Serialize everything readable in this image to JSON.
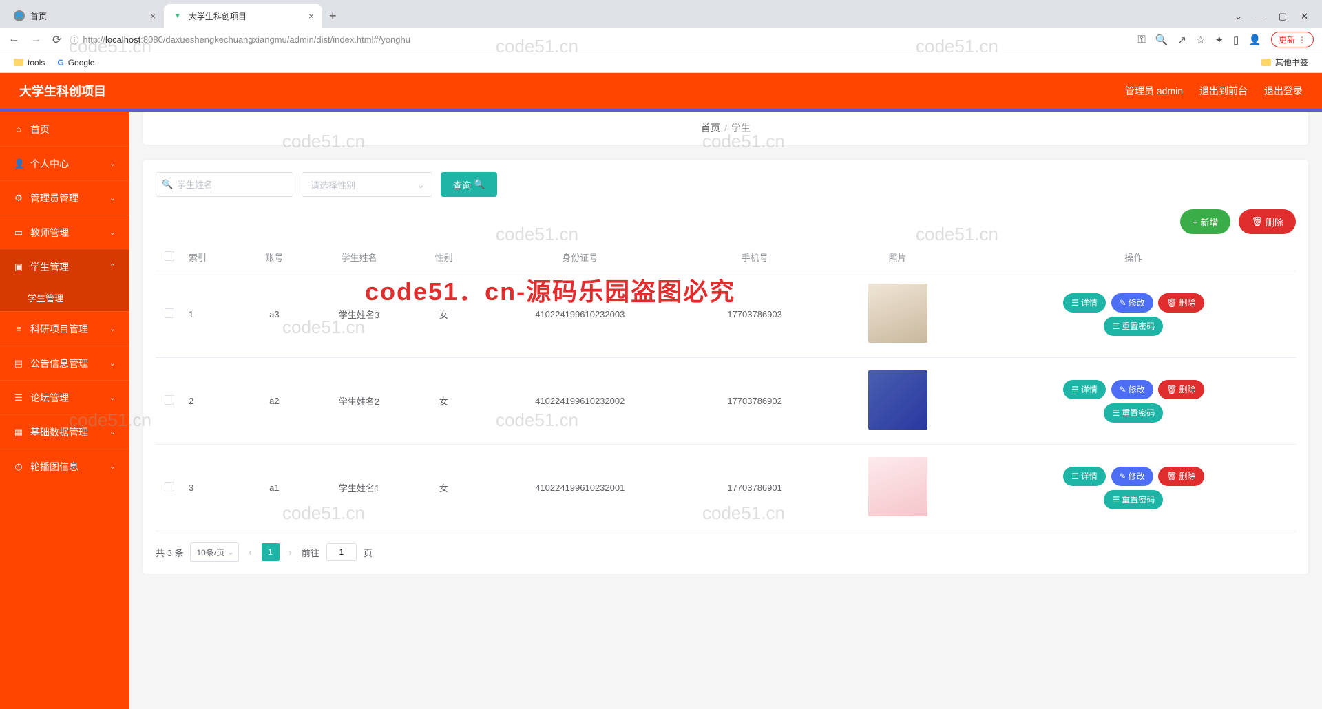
{
  "browser": {
    "tabs": [
      {
        "label": "首页",
        "active": false
      },
      {
        "label": "大学生科创项目",
        "active": true
      }
    ],
    "url_prefix": "http://",
    "url_host": "localhost",
    "url_rest": ":8080/daxueshengkechuangxiangmu/admin/dist/index.html#/yonghu",
    "update": "更新",
    "bookmarks": {
      "tools": "tools",
      "google": "Google",
      "other": "其他书签"
    }
  },
  "header": {
    "title": "大学生科创项目",
    "user": "管理员 admin",
    "front": "退出到前台",
    "logout": "退出登录"
  },
  "sidebar": [
    {
      "icon": "⌂",
      "label": "首页",
      "exp": ""
    },
    {
      "icon": "👤",
      "label": "个人中心",
      "exp": "⌄"
    },
    {
      "icon": "⚙",
      "label": "管理员管理",
      "exp": "⌄"
    },
    {
      "icon": "▭",
      "label": "教师管理",
      "exp": "⌄"
    },
    {
      "icon": "▣",
      "label": "学生管理",
      "exp": "⌃",
      "active": true,
      "sublabel": "学生管理"
    },
    {
      "icon": "≡",
      "label": "科研项目管理",
      "exp": "⌄"
    },
    {
      "icon": "▤",
      "label": "公告信息管理",
      "exp": "⌄"
    },
    {
      "icon": "☰",
      "label": "论坛管理",
      "exp": "⌄"
    },
    {
      "icon": "▦",
      "label": "基础数据管理",
      "exp": "⌄"
    },
    {
      "icon": "◷",
      "label": "轮播图信息",
      "exp": "⌄"
    }
  ],
  "breadcrumb": {
    "home": "首页",
    "current": "学生"
  },
  "filters": {
    "name_placeholder": "学生姓名",
    "gender_placeholder": "请选择性别",
    "search": "查询"
  },
  "actions": {
    "add": "新增",
    "delete": "删除"
  },
  "table": {
    "headers": [
      "索引",
      "账号",
      "学生姓名",
      "性别",
      "身份证号",
      "手机号",
      "照片",
      "操作"
    ],
    "ops": {
      "detail": "详情",
      "edit": "修改",
      "del": "删除",
      "reset": "重置密码"
    },
    "rows": [
      {
        "idx": "1",
        "acct": "a3",
        "name": "学生姓名3",
        "gender": "女",
        "idcard": "410224199610232003",
        "phone": "17703786903",
        "photoCls": "p1"
      },
      {
        "idx": "2",
        "acct": "a2",
        "name": "学生姓名2",
        "gender": "女",
        "idcard": "410224199610232002",
        "phone": "17703786902",
        "photoCls": "p2"
      },
      {
        "idx": "3",
        "acct": "a1",
        "name": "学生姓名1",
        "gender": "女",
        "idcard": "410224199610232001",
        "phone": "17703786901",
        "photoCls": "p3"
      }
    ]
  },
  "pagination": {
    "total": "共 3 条",
    "per": "10条/页",
    "goto": "前往",
    "page": "1",
    "unit": "页"
  },
  "watermarks": {
    "wm": "code51.cn",
    "red": "code51．cn-源码乐园盗图必究"
  }
}
